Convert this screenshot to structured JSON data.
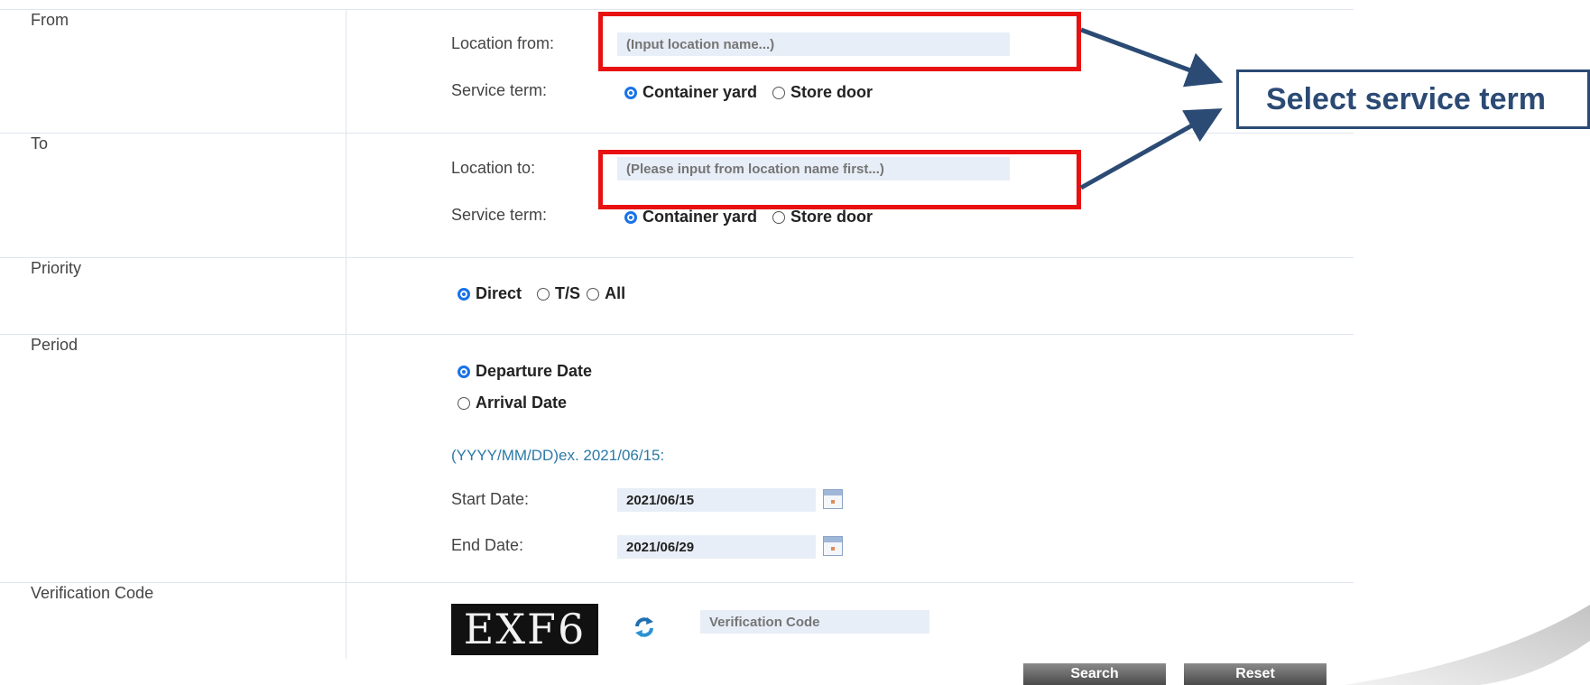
{
  "from": {
    "label": "From",
    "location_label": "Location from:",
    "location_placeholder": "(Input location name...)",
    "service_term_label": "Service term:",
    "options": [
      "Container yard",
      "Store door"
    ],
    "selected": "Container yard"
  },
  "to": {
    "label": "To",
    "location_label": "Location to:",
    "location_placeholder": "(Please input from location name first...)",
    "service_term_label": "Service term:",
    "options": [
      "Container yard",
      "Store door"
    ],
    "selected": "Container yard"
  },
  "priority": {
    "label": "Priority",
    "options": [
      "Direct",
      "T/S",
      "All"
    ],
    "selected": "Direct"
  },
  "period": {
    "label": "Period",
    "options": [
      "Departure Date",
      "Arrival Date"
    ],
    "selected": "Departure Date",
    "format_hint": "(YYYY/MM/DD)ex. 2021/06/15:",
    "start_label": "Start Date:",
    "start_value": "2021/06/15",
    "end_label": "End Date:",
    "end_value": "2021/06/29"
  },
  "verification": {
    "label": "Verification Code",
    "captcha_text": "EXF6",
    "placeholder": "Verification Code"
  },
  "buttons": {
    "search": "Search",
    "reset": "Reset"
  },
  "callout": {
    "text": "Select service term"
  },
  "colors": {
    "highlight_red": "#e81010",
    "callout_navy": "#2b4a74",
    "radio_blue": "#1a73e8",
    "input_bg": "#e8eef7",
    "hint_blue": "#2c7aa8"
  },
  "icons": {
    "calendar": "calendar-icon",
    "refresh": "refresh-icon"
  }
}
